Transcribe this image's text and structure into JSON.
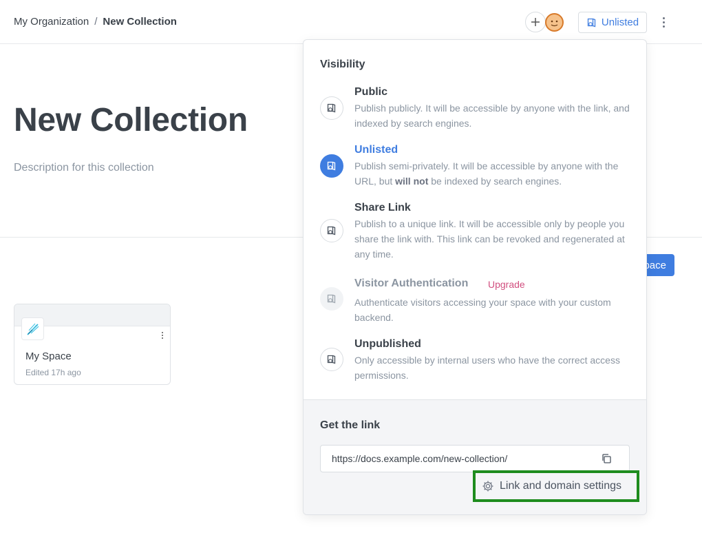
{
  "header": {
    "breadcrumb": {
      "org": "My Organization",
      "separator": "/",
      "current": "New Collection"
    },
    "visibility_button_label": "Unlisted"
  },
  "page": {
    "title": "New Collection",
    "description": "Description for this collection",
    "new_space_button_label": "pace"
  },
  "space_card": {
    "name": "My Space",
    "edited": "Edited 17h ago"
  },
  "visibility_popover": {
    "heading": "Visibility",
    "options": [
      {
        "title": "Public",
        "description": "Publish publicly. It will be accessible by anyone with the link, and indexed by search engines."
      },
      {
        "title": "Unlisted",
        "description_before": "Publish semi-privately. It will be accessible by anyone with the URL, but",
        "description_bold": "will not",
        "description_after": "be indexed by search engines.",
        "selected": true
      },
      {
        "title": "Share Link",
        "description": "Publish to a unique link. It will be accessible only by people you share the link with. This link can be revoked and regenerated at any time."
      },
      {
        "title": "Visitor Authentication",
        "badge": "Upgrade",
        "description": "Authenticate visitors accessing your space with your custom backend.",
        "disabled": true
      },
      {
        "title": "Unpublished",
        "description": "Only accessible by internal users who have the correct access permissions."
      }
    ],
    "link_section": {
      "heading": "Get the link",
      "url": "https://docs.example.com/new-collection/",
      "settings_label": "Link and domain settings"
    }
  },
  "colors": {
    "accent": "#3f7de0",
    "upgrade": "#d14f7f",
    "highlight_border": "#1e8c1e"
  },
  "icons": {
    "plus": "plus-icon",
    "book_globe": "book-globe-icon",
    "kebab": "kebab-menu-icon",
    "copy": "copy-icon",
    "gear": "gear-icon"
  }
}
